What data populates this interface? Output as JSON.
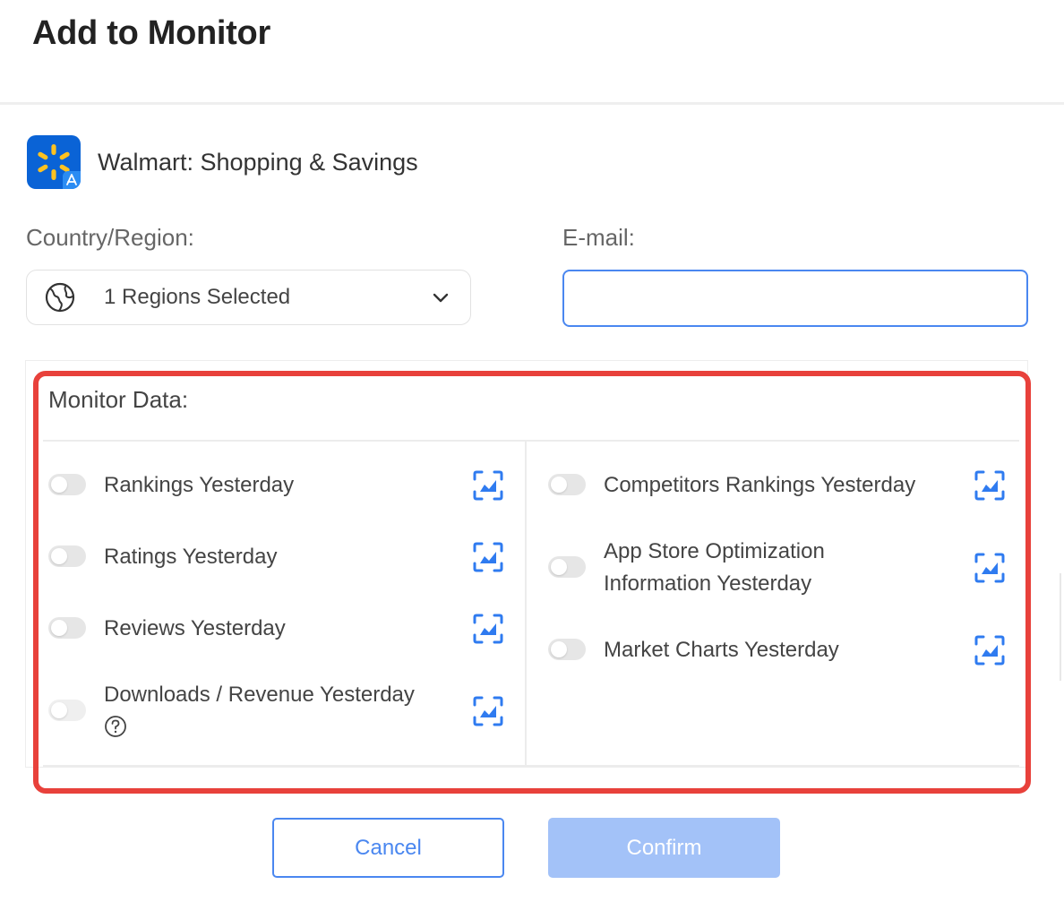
{
  "dialog": {
    "title": "Add to Monitor"
  },
  "app": {
    "name": "Walmart: Shopping & Savings",
    "icon": "walmart-spark-icon",
    "brand_color": "#0a63d6",
    "spark_color": "#ffc220"
  },
  "country_region": {
    "label": "Country/Region:",
    "selected": "1 Regions Selected",
    "icon": "globe-icon"
  },
  "email": {
    "label": "E-mail:",
    "value": "",
    "placeholder": ""
  },
  "monitor_data": {
    "title": "Monitor Data:",
    "left_items": [
      {
        "label": "Rankings Yesterday",
        "enabled": false
      },
      {
        "label": "Ratings Yesterday",
        "enabled": false
      },
      {
        "label": "Reviews Yesterday",
        "enabled": false
      },
      {
        "label": "Downloads / Revenue Yesterday",
        "enabled": false,
        "disabled": true,
        "help_icon": "question-circle-icon"
      }
    ],
    "right_items": [
      {
        "label": "Competitors Rankings Yesterday",
        "enabled": false
      },
      {
        "label_line1": "App Store Optimization",
        "label_line2": "Information Yesterday",
        "enabled": false
      },
      {
        "label": "Market Charts Yesterday",
        "enabled": false
      }
    ],
    "highlight_color": "#e8413b"
  },
  "buttons": {
    "cancel": "Cancel",
    "confirm": "Confirm"
  },
  "colors": {
    "accent": "#4a87f0",
    "confirm_disabled": "#a3c2f8"
  }
}
